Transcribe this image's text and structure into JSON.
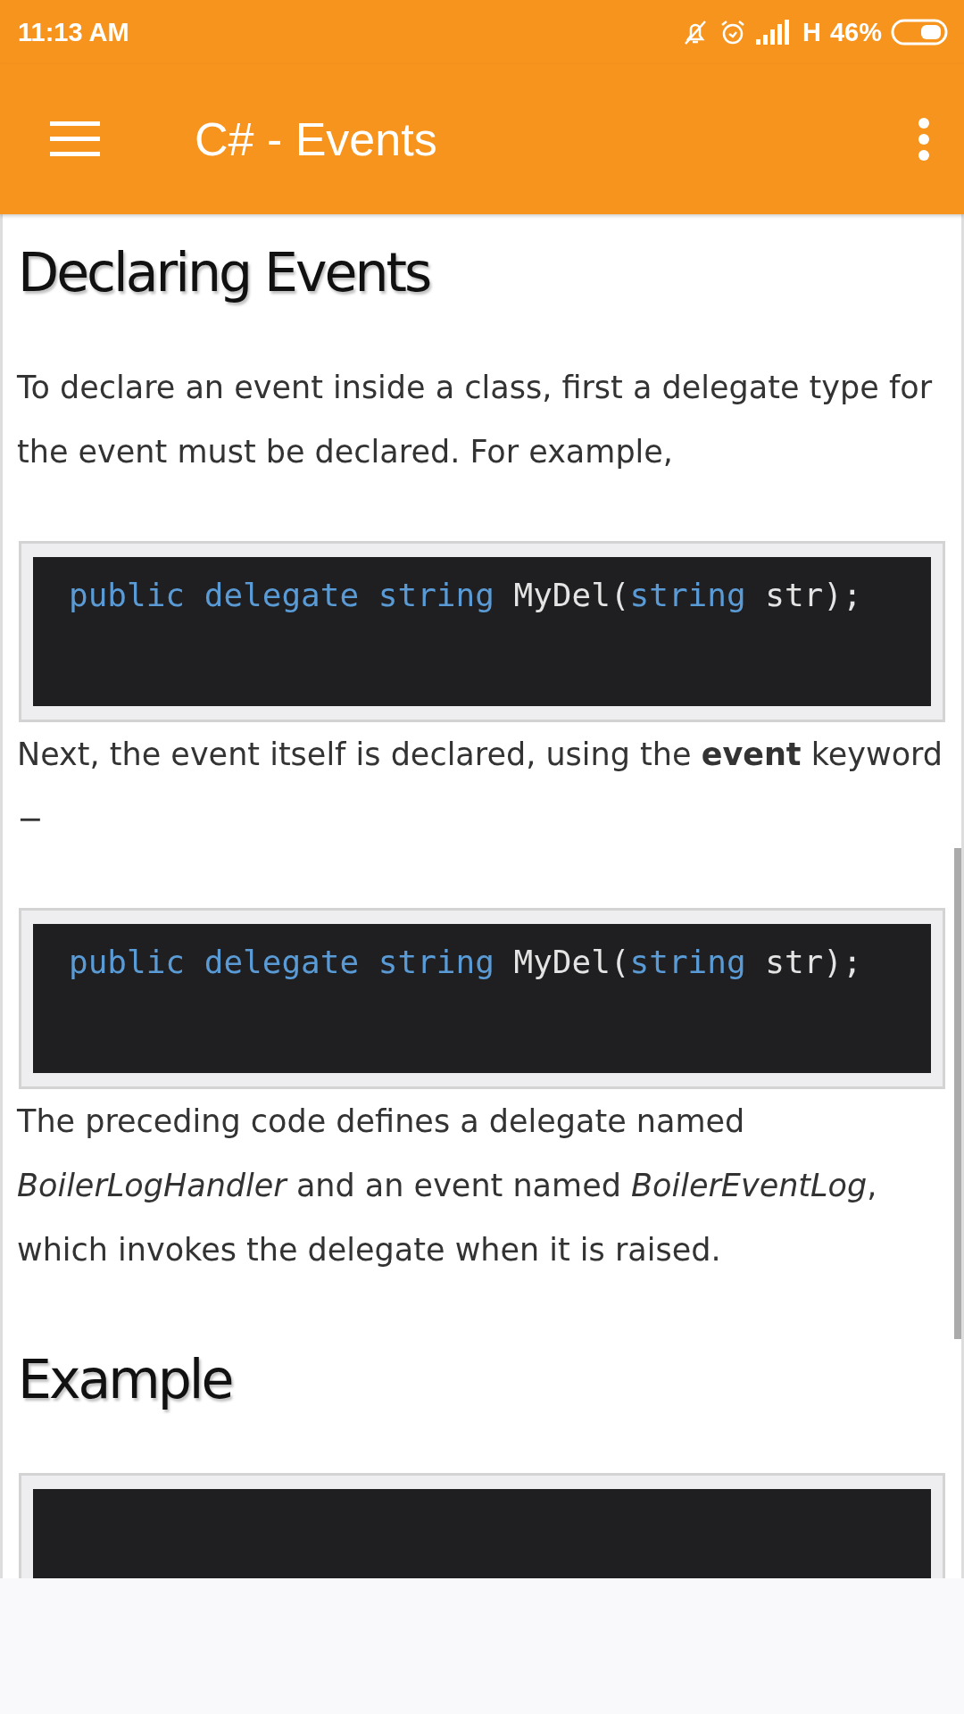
{
  "status_bar": {
    "time": "11:13 AM",
    "network": "H",
    "battery": "46%"
  },
  "app_bar": {
    "title": "C# - Events"
  },
  "content": [
    {
      "kind": "heading",
      "text": "Declaring Events"
    },
    {
      "kind": "paragraph",
      "text": "To declare an event inside a class, first a delegate type for the event must be declared. For example,"
    },
    {
      "kind": "code",
      "tokens": [
        {
          "kind": "keyword",
          "text": "public delegate string"
        },
        {
          "kind": "plain",
          "text": " MyDel("
        },
        {
          "kind": "keyword",
          "text": "string"
        },
        {
          "kind": "plain",
          "text": " str);"
        }
      ]
    },
    {
      "kind": "paragraph",
      "text": "Next, the event itself is declared, using the **event** keyword −"
    },
    {
      "kind": "code",
      "tokens": [
        {
          "kind": "keyword",
          "text": "public delegate string"
        },
        {
          "kind": "plain",
          "text": " MyDel("
        },
        {
          "kind": "keyword",
          "text": "string"
        },
        {
          "kind": "plain",
          "text": " str);"
        }
      ]
    },
    {
      "kind": "paragraph",
      "text": "The preceding code defines a delegate named *BoilerLogHandler* and an event named *BoilerEventLog*, which invokes the delegate when it is raised."
    },
    {
      "kind": "heading",
      "text": "Example"
    },
    {
      "kind": "code"
    }
  ]
}
